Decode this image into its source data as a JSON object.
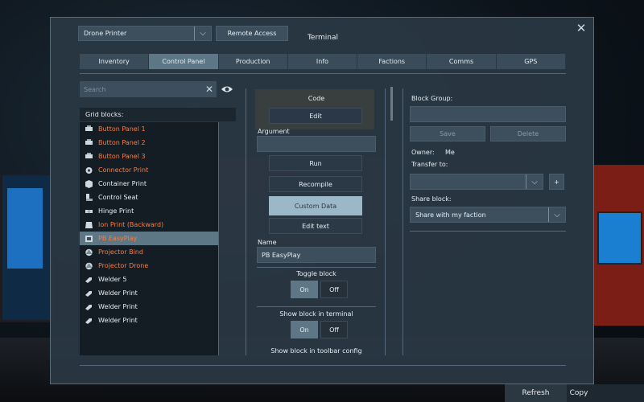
{
  "window": {
    "title": "Terminal"
  },
  "header": {
    "block_select": "Drone Printer",
    "remote_access_label": "Remote Access"
  },
  "tabs": [
    {
      "label": "Inventory"
    },
    {
      "label": "Control Panel"
    },
    {
      "label": "Production"
    },
    {
      "label": "Info"
    },
    {
      "label": "Factions"
    },
    {
      "label": "Comms"
    },
    {
      "label": "GPS"
    }
  ],
  "search": {
    "placeholder": "Search"
  },
  "grid": {
    "header": "Grid blocks:",
    "items": [
      {
        "label": "Button Panel 1",
        "color": "orange",
        "icon": "button-panel-icon"
      },
      {
        "label": "Button Panel 2",
        "color": "orange",
        "icon": "button-panel-icon"
      },
      {
        "label": "Button Panel 3",
        "color": "orange",
        "icon": "button-panel-icon"
      },
      {
        "label": "Connector Print",
        "color": "orange",
        "icon": "connector-icon"
      },
      {
        "label": "Container Print",
        "color": "white",
        "icon": "container-icon"
      },
      {
        "label": "Control Seat",
        "color": "white",
        "icon": "seat-icon"
      },
      {
        "label": "Hinge Print",
        "color": "white",
        "icon": "hinge-icon"
      },
      {
        "label": "Ion Print (Backward)",
        "color": "orange",
        "icon": "thruster-icon"
      },
      {
        "label": "PB EasyPlay",
        "color": "orange",
        "icon": "programmable-block-icon",
        "selected": true
      },
      {
        "label": "Projector Bind",
        "color": "orange",
        "icon": "projector-icon"
      },
      {
        "label": "Projector Drone",
        "color": "orange",
        "icon": "projector-icon"
      },
      {
        "label": "Welder 5",
        "color": "white",
        "icon": "welder-icon"
      },
      {
        "label": "Welder Print",
        "color": "white",
        "icon": "welder-icon"
      },
      {
        "label": "Welder Print",
        "color": "white",
        "icon": "welder-icon"
      },
      {
        "label": "Welder Print",
        "color": "white",
        "icon": "welder-icon"
      }
    ]
  },
  "middle": {
    "code_label": "Code",
    "edit_label": "Edit",
    "argument_label": "Argument",
    "argument_value": "",
    "run_label": "Run",
    "recompile_label": "Recompile",
    "custom_data_label": "Custom Data",
    "edit_text_label": "Edit text",
    "name_label": "Name",
    "name_value": "PB EasyPlay",
    "toggle_block_label": "Toggle block",
    "show_terminal_label": "Show block in terminal",
    "show_toolbar_label": "Show block in toolbar config",
    "on_label": "On",
    "off_label": "Off"
  },
  "right": {
    "block_group_label": "Block Group:",
    "block_group_value": "",
    "save_label": "Save",
    "delete_label": "Delete",
    "owner_label": "Owner:",
    "owner_value": "Me",
    "transfer_label": "Transfer to:",
    "transfer_value": "",
    "plus_label": "+",
    "share_label": "Share block:",
    "share_value": "Share with my faction"
  },
  "bottom": {
    "refresh_label": "Refresh",
    "copy_label": "Copy"
  },
  "colors": {
    "accent": "#5d7787",
    "orange_text": "#ff7a3c",
    "highlight": "#9ab8c8"
  }
}
